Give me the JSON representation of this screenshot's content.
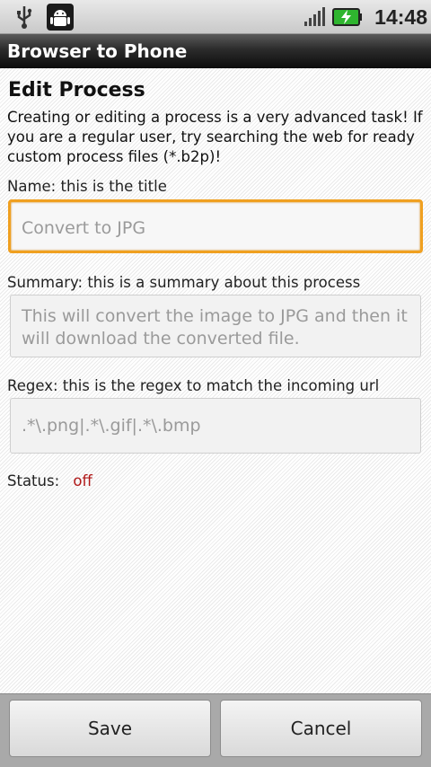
{
  "status_bar": {
    "time": "14:48",
    "icons": [
      "usb-icon",
      "android-debug-icon",
      "signal-icon",
      "battery-charging-icon"
    ]
  },
  "app_title": "Browser to Phone",
  "page": {
    "heading": "Edit Process",
    "intro": "Creating or editing a process is a very advanced task! If you are a regular user, try searching the web for ready custom process files (*.b2p)!"
  },
  "fields": {
    "name": {
      "label": "Name: this is the title",
      "placeholder": "Convert to JPG"
    },
    "summary": {
      "label": "Summary: this is a summary about this process",
      "placeholder": "This will convert the image to JPG and then it will download the converted file."
    },
    "regex": {
      "label": "Regex: this is the regex to match the incoming url",
      "placeholder": ".*\\.png|.*\\.gif|.*\\.bmp"
    }
  },
  "status": {
    "label": "Status:",
    "value": "off"
  },
  "buttons": {
    "save": "Save",
    "cancel": "Cancel"
  },
  "colors": {
    "focus": "#f0a020",
    "status_off": "#b01818",
    "title_bar": "#1a1a1a"
  }
}
